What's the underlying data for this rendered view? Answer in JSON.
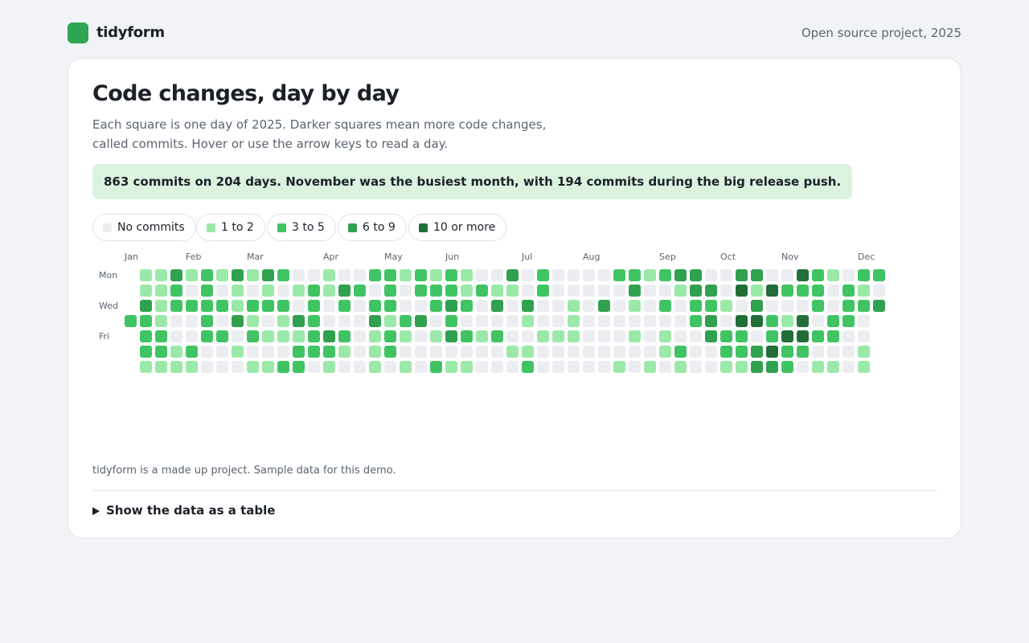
{
  "header": {
    "brand": "tidyform",
    "project_note": "Open source project, 2025"
  },
  "main": {
    "title": "Code changes, day by day",
    "description": "Each square is one day of 2025. Darker squares mean more code changes, called commits. Hover or use the arrow keys to read a day.",
    "summary": "863 commits on 204 days. November was the busiest month, with 194 commits during the big release push.",
    "legend": [
      {
        "label": "No commits",
        "color": "#ebedf0"
      },
      {
        "label": "1 to 2",
        "color": "#9be9a8"
      },
      {
        "label": "3 to 5",
        "color": "#40c463"
      },
      {
        "label": "6 to 9",
        "color": "#30a14e"
      },
      {
        "label": "10 or more",
        "color": "#216e39"
      }
    ],
    "footnote": "tidyform is a made up project. Sample data for this demo.",
    "table_toggle": "Show the data as a table"
  },
  "chart_data": {
    "type": "heatmap",
    "year": 2025,
    "months": [
      "Jan",
      "Feb",
      "Mar",
      "Apr",
      "May",
      "Jun",
      "Jul",
      "Aug",
      "Sep",
      "Oct",
      "Nov",
      "Dec"
    ],
    "day_labels": [
      "Mon",
      "",
      "Wed",
      "",
      "Fri",
      "",
      ""
    ],
    "levels": [
      "No commits",
      "1 to 2",
      "3 to 5",
      "6 to 9",
      "10 or more"
    ],
    "total_commits": 863,
    "active_days": 204,
    "weeks": [
      [
        -1,
        -1,
        -1,
        2,
        -1,
        -1,
        -1
      ],
      [
        1,
        1,
        3,
        2,
        2,
        2,
        1
      ],
      [
        1,
        1,
        1,
        1,
        2,
        2,
        1
      ],
      [
        3,
        2,
        2,
        0,
        0,
        1,
        1
      ],
      [
        1,
        0,
        2,
        0,
        0,
        2,
        1
      ],
      [
        2,
        2,
        2,
        2,
        2,
        0,
        0
      ],
      [
        1,
        0,
        2,
        0,
        2,
        0,
        0
      ],
      [
        3,
        1,
        1,
        3,
        0,
        1,
        0
      ],
      [
        1,
        0,
        2,
        1,
        2,
        0,
        1
      ],
      [
        3,
        1,
        2,
        0,
        1,
        0,
        1
      ],
      [
        2,
        0,
        2,
        1,
        1,
        0,
        2
      ],
      [
        0,
        1,
        0,
        3,
        1,
        2,
        2
      ],
      [
        0,
        2,
        2,
        2,
        2,
        2,
        0
      ],
      [
        1,
        1,
        0,
        0,
        3,
        2,
        1
      ],
      [
        0,
        3,
        2,
        0,
        2,
        1,
        0
      ],
      [
        0,
        2,
        0,
        0,
        0,
        0,
        0
      ],
      [
        2,
        0,
        2,
        3,
        1,
        1,
        1
      ],
      [
        2,
        2,
        2,
        1,
        2,
        2,
        0
      ],
      [
        1,
        0,
        0,
        2,
        1,
        0,
        1
      ],
      [
        2,
        2,
        0,
        3,
        0,
        0,
        0
      ],
      [
        1,
        2,
        2,
        0,
        1,
        0,
        2
      ],
      [
        2,
        2,
        3,
        2,
        3,
        0,
        1
      ],
      [
        1,
        1,
        2,
        0,
        2,
        0,
        1
      ],
      [
        0,
        2,
        0,
        0,
        1,
        0,
        0
      ],
      [
        0,
        1,
        3,
        0,
        2,
        0,
        0
      ],
      [
        3,
        1,
        0,
        0,
        0,
        1,
        0
      ],
      [
        0,
        0,
        3,
        1,
        0,
        1,
        2
      ],
      [
        2,
        2,
        0,
        0,
        1,
        0,
        0
      ],
      [
        0,
        0,
        0,
        0,
        1,
        0,
        0
      ],
      [
        0,
        0,
        1,
        1,
        1,
        0,
        0
      ],
      [
        0,
        0,
        0,
        0,
        0,
        0,
        0
      ],
      [
        0,
        0,
        3,
        0,
        0,
        0,
        0
      ],
      [
        2,
        0,
        0,
        0,
        0,
        0,
        1
      ],
      [
        2,
        3,
        1,
        0,
        1,
        0,
        0
      ],
      [
        1,
        0,
        0,
        0,
        0,
        0,
        1
      ],
      [
        2,
        0,
        2,
        0,
        1,
        1,
        0
      ],
      [
        3,
        1,
        0,
        0,
        0,
        2,
        1
      ],
      [
        3,
        3,
        2,
        2,
        0,
        0,
        0
      ],
      [
        0,
        3,
        2,
        3,
        3,
        0,
        0
      ],
      [
        0,
        0,
        1,
        0,
        2,
        2,
        1
      ],
      [
        3,
        4,
        0,
        4,
        2,
        2,
        1
      ],
      [
        3,
        1,
        3,
        4,
        0,
        3,
        3
      ],
      [
        0,
        4,
        0,
        2,
        2,
        4,
        3
      ],
      [
        0,
        2,
        0,
        1,
        4,
        2,
        2
      ],
      [
        4,
        2,
        0,
        4,
        4,
        2,
        0
      ],
      [
        2,
        2,
        2,
        0,
        2,
        0,
        1
      ],
      [
        1,
        0,
        0,
        2,
        2,
        0,
        1
      ],
      [
        0,
        2,
        2,
        2,
        0,
        0,
        0
      ],
      [
        2,
        1,
        2,
        0,
        0,
        1,
        1
      ],
      [
        2,
        0,
        3,
        -1,
        -1,
        -1,
        -1
      ]
    ]
  }
}
